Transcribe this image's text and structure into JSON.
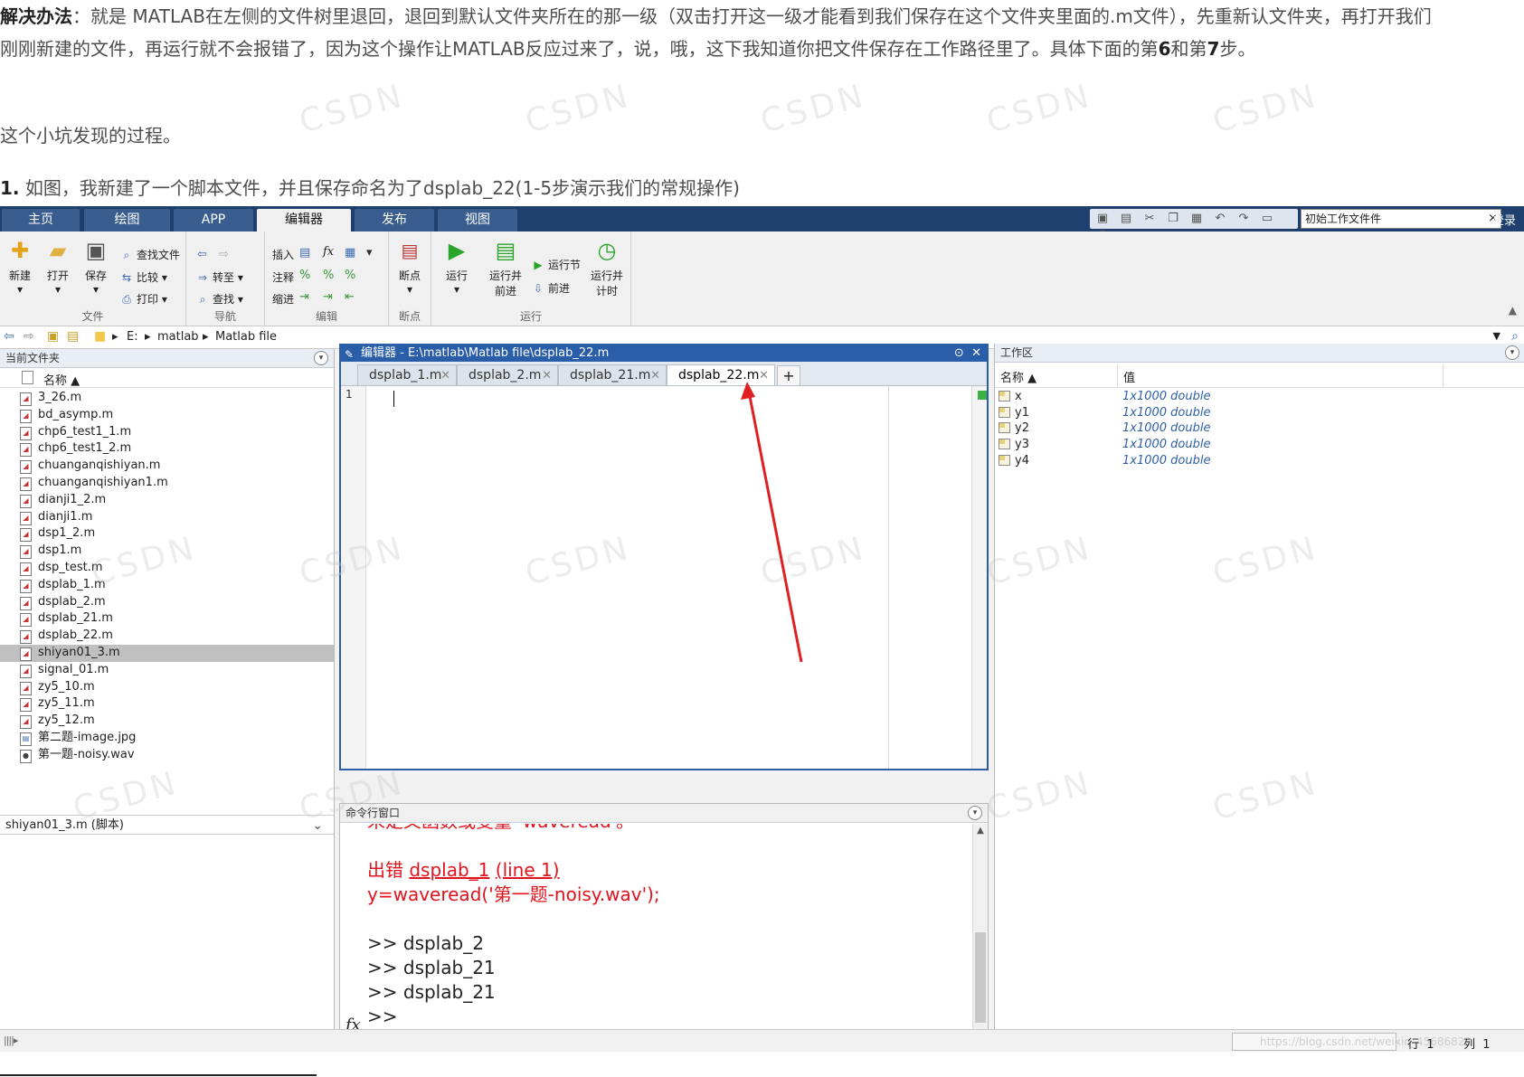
{
  "article": {
    "para1_bold": "解决办法",
    "para1_text": "：就是 MATLAB在左侧的文件树里退回，退回到默认文件夹所在的那一级（双击打开这一级才能看到我们保存在这个文件夹里面的.m文件），先重新认文件夹，再打开我们刚刚新建的文件，再运行就不会报错了，因为这个操作让MATLAB反应过来了，说，哦，这下我知道你把文件保存在工作路径里了。具体下面的第",
    "para1_b6": "6",
    "para1_mid": "和第",
    "para1_b7": "7",
    "para1_end": "步。",
    "para2": "这个小坑发现的过程。",
    "para3_bold": "1.",
    "para3_text": " 如图，我新建了一个脚本文件，并且保存命名为了dsplab_22(1-5步演示我们的常规操作)"
  },
  "ribbon": {
    "tabs": [
      "主页",
      "绘图",
      "APP",
      "编辑器",
      "发布",
      "视图"
    ],
    "search_value": "初始工作文件件",
    "login": "登录"
  },
  "toolstrip": {
    "file_group": "文件",
    "nav_group": "导航",
    "edit_group": "编辑",
    "breakpoint_group": "断点",
    "run_group": "运行",
    "new": "新建",
    "open": "打开",
    "save": "保存",
    "find_files": "查找文件",
    "compare": "比较",
    "print": "打印",
    "goto": "转至",
    "find": "查找",
    "insert": "插入",
    "comment": "注释",
    "indent": "缩进",
    "breakpoints": "断点",
    "run": "运行",
    "run_advance_1": "运行并",
    "run_advance_2": "前进",
    "run_section": "运行节",
    "advance": "前进",
    "run_time_1": "运行并",
    "run_time_2": "计时"
  },
  "address": {
    "crumbs": [
      "E:",
      "matlab",
      "Matlab file"
    ]
  },
  "files_panel": {
    "title": "当前文件夹",
    "col_name": "名称 ▲",
    "files": [
      "3_26.m",
      "bd_asymp.m",
      "chp6_test1_1.m",
      "chp6_test1_2.m",
      "chuanganqishiyan.m",
      "chuanganqishiyan1.m",
      "dianji1_2.m",
      "dianji1.m",
      "dsp1_2.m",
      "dsp1.m",
      "dsp_test.m",
      "dsplab_1.m",
      "dsplab_2.m",
      "dsplab_21.m",
      "dsplab_22.m",
      "shiyan01_3.m",
      "signal_01.m",
      "zy5_10.m",
      "zy5_11.m",
      "zy5_12.m",
      "第二题-image.jpg",
      "第一题-noisy.wav"
    ],
    "selected": "shiyan01_3.m",
    "details": "shiyan01_3.m  (脚本)"
  },
  "editor": {
    "title": "编辑器 - E:\\matlab\\Matlab file\\dsplab_22.m",
    "tabs": [
      "dsplab_1.m",
      "dsplab_2.m",
      "dsplab_21.m",
      "dsplab_22.m"
    ],
    "active_tab": "dsplab_22.m",
    "line_number": "1"
  },
  "command_window": {
    "title": "命令行窗口",
    "cut_line": "未定义函数或变量 'waveread'。",
    "error_prefix": "出错 ",
    "error_link": "dsplab_1",
    "error_line_link": "(line 1)",
    "error_code": "y=waveread('第一题-noisy.wav');",
    "cmd1": ">> dsplab_2",
    "cmd2": ">> dsplab_21",
    "cmd3": ">> dsplab_21",
    "prompt": ">>"
  },
  "workspace": {
    "title": "工作区",
    "col_name": "名称 ▲",
    "col_value": "值",
    "vars": [
      {
        "name": "x",
        "value": "1x1000 double"
      },
      {
        "name": "y1",
        "value": "1x1000 double"
      },
      {
        "name": "y2",
        "value": "1x1000 double"
      },
      {
        "name": "y3",
        "value": "1x1000 double"
      },
      {
        "name": "y4",
        "value": "1x1000 double"
      }
    ]
  },
  "statusbar": {
    "watermark": "https://blog.csdn.net/weixin_45686822",
    "row_label": "行",
    "row_value": "1",
    "col_label": "列",
    "col_value": "1"
  },
  "watermark_text": "CSDN",
  "colors": {
    "accent_blue": "#2b5ea8",
    "error_red": "#e0141e",
    "annotation_arrow": "#e02020"
  },
  "annotation": {
    "arrow_target": "dsplab_22.m tab"
  }
}
